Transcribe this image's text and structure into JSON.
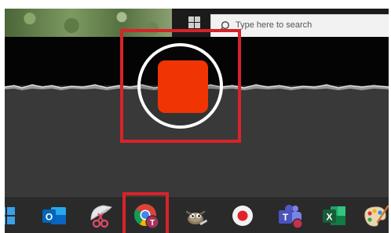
{
  "search": {
    "placeholder": "Type here to search"
  },
  "colors": {
    "highlight": "#d8232a",
    "stop": "#f03404",
    "ring": "#ffffff",
    "taskbar": "#2a2a2a"
  },
  "taskbar": {
    "items": [
      {
        "name": "windows-start-icon"
      },
      {
        "name": "outlook-icon",
        "letter": "O"
      },
      {
        "name": "snipping-tool-icon"
      },
      {
        "name": "chrome-icon",
        "badge": "T"
      },
      {
        "name": "gimp-icon"
      },
      {
        "name": "screen-recorder-icon"
      },
      {
        "name": "teams-icon",
        "letter": "T"
      },
      {
        "name": "excel-icon",
        "letter": "X"
      },
      {
        "name": "paint-icon"
      }
    ]
  }
}
